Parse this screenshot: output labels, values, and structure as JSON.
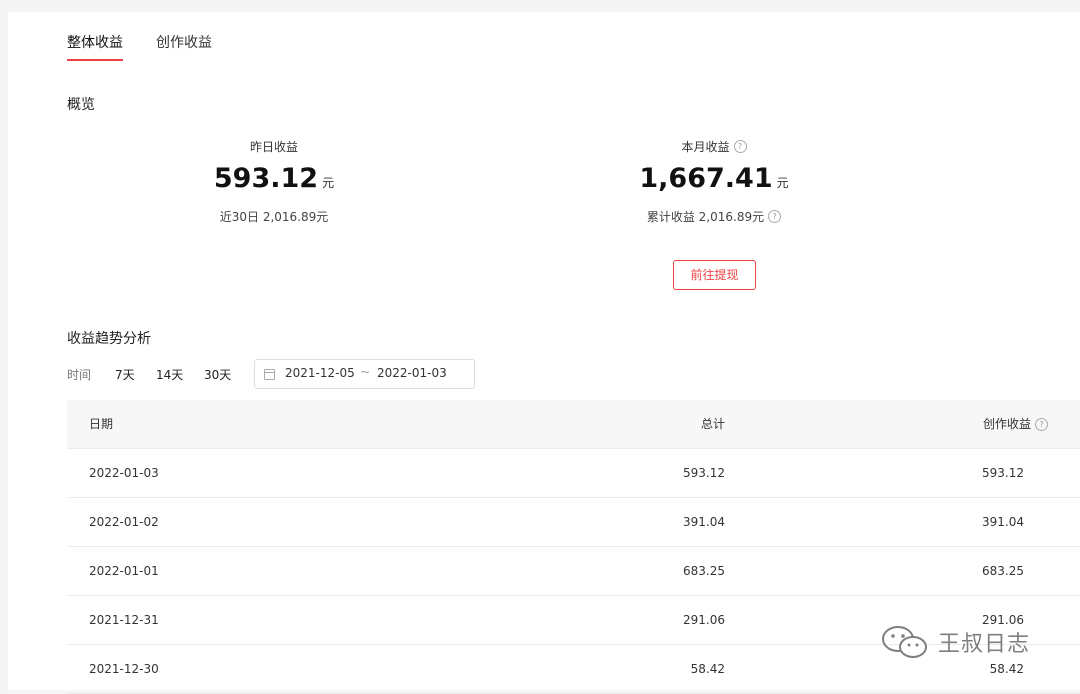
{
  "tabs": [
    {
      "label": "整体收益",
      "active": true
    },
    {
      "label": "创作收益",
      "active": false
    }
  ],
  "overview": {
    "title": "概览",
    "yesterday": {
      "label": "昨日收益",
      "value": "593.12",
      "unit": "元",
      "sub": "近30日 2,016.89元"
    },
    "month": {
      "label": "本月收益",
      "value": "1,667.41",
      "unit": "元",
      "sub": "累计收益 2,016.89元"
    },
    "withdraw_label": "前往提现"
  },
  "trend": {
    "title": "收益趋势分析",
    "time_label": "时间",
    "ranges": [
      "7天",
      "14天",
      "30天"
    ],
    "date_start": "2021-12-05",
    "date_separator": "~",
    "date_end": "2022-01-03"
  },
  "table": {
    "headers": {
      "date": "日期",
      "total": "总计",
      "creation": "创作收益"
    },
    "rows": [
      {
        "date": "2022-01-03",
        "total": "593.12",
        "creation": "593.12"
      },
      {
        "date": "2022-01-02",
        "total": "391.04",
        "creation": "391.04"
      },
      {
        "date": "2022-01-01",
        "total": "683.25",
        "creation": "683.25"
      },
      {
        "date": "2021-12-31",
        "total": "291.06",
        "creation": "291.06"
      },
      {
        "date": "2021-12-30",
        "total": "58.42",
        "creation": "58.42"
      }
    ]
  },
  "watermark": {
    "text": "王叔日志",
    "icon": "wechat-icon"
  },
  "colors": {
    "accent": "#f04142",
    "background": "#f5f5f5",
    "header_bg": "#f7f7f7"
  }
}
